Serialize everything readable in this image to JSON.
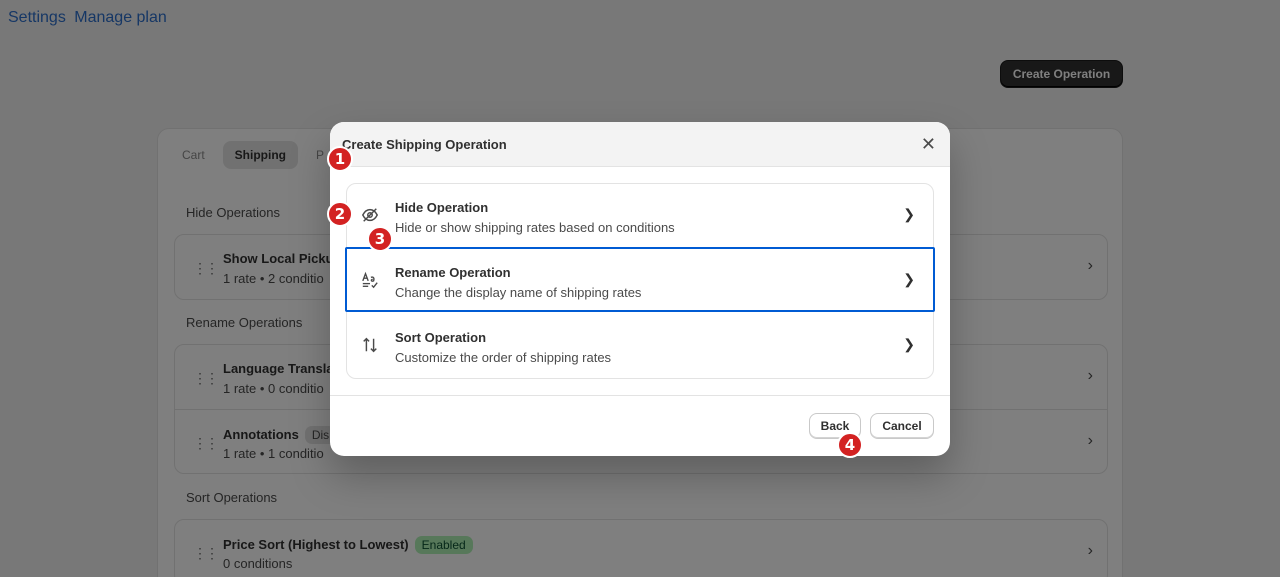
{
  "header": {
    "links": [
      "Settings",
      "Manage plan"
    ],
    "create_button": "Create Operation"
  },
  "tabs": [
    "Cart",
    "Shipping",
    "P"
  ],
  "sections": {
    "hide": {
      "title": "Hide Operations",
      "items": [
        {
          "title": "Show Local Picku",
          "sub": "1 rate •  2 conditio"
        }
      ]
    },
    "rename": {
      "title": "Rename Operations",
      "items": [
        {
          "title": "Language Transla",
          "sub": "1 rate •  0 conditio",
          "badge": ""
        },
        {
          "title": "Annotations",
          "sub": "1 rate •  1 conditio",
          "badge": "Dis"
        }
      ]
    },
    "sort": {
      "title": "Sort Operations",
      "items": [
        {
          "title": "Price Sort (Highest to Lowest)",
          "sub": "0 conditions",
          "badge": "Enabled"
        }
      ]
    }
  },
  "modal": {
    "title": "Create Shipping Operation",
    "options": [
      {
        "title": "Hide Operation",
        "sub": "Hide or show shipping rates based on conditions",
        "icon": "eye-off-icon"
      },
      {
        "title": "Rename Operation",
        "sub": "Change the display name of shipping rates",
        "icon": "text-rename-icon"
      },
      {
        "title": "Sort Operation",
        "sub": "Customize the order of shipping rates",
        "icon": "sort-arrows-icon"
      }
    ],
    "back_label": "Back",
    "cancel_label": "Cancel"
  },
  "markers": [
    "1",
    "2",
    "3",
    "4"
  ],
  "colors": {
    "accent": "#005bd3",
    "marker": "#d32222",
    "enabled_badge": "#aff0b5"
  }
}
